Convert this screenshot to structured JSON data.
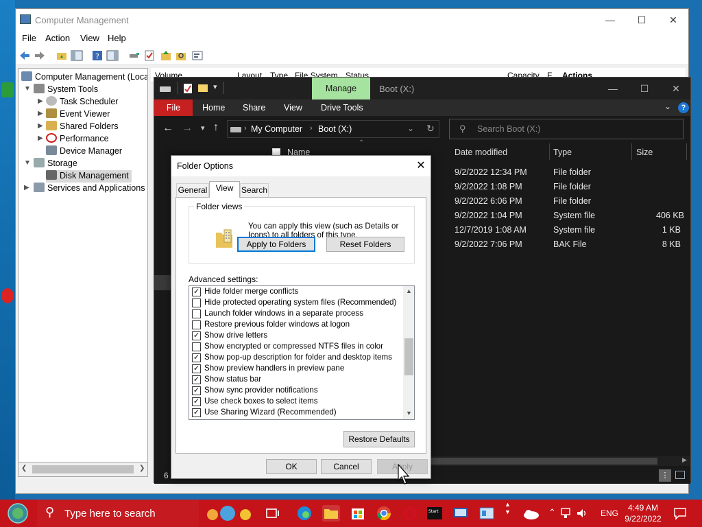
{
  "cm": {
    "title": "Computer Management",
    "menu": [
      "File",
      "Action",
      "View",
      "Help"
    ],
    "tree": {
      "root": "Computer Management (Local",
      "system_tools": "System Tools",
      "task_scheduler": "Task Scheduler",
      "event_viewer": "Event Viewer",
      "shared_folders": "Shared Folders",
      "performance": "Performance",
      "device_manager": "Device Manager",
      "storage": "Storage",
      "disk_management": "Disk Management",
      "services": "Services and Applications"
    },
    "list_headers": [
      "Volume",
      "Layout",
      "Type",
      "File System",
      "Status",
      "Capacity",
      "F",
      "Actions"
    ]
  },
  "fe": {
    "manage_tab": "Manage",
    "title": "Boot (X:)",
    "ribbon": [
      "File",
      "Home",
      "Share",
      "View",
      "Drive Tools"
    ],
    "breadcrumb": [
      "My Computer",
      "Boot (X:)"
    ],
    "search_placeholder": "Search Boot (X:)",
    "columns": [
      "Name",
      "Date modified",
      "Type",
      "Size"
    ],
    "rows": [
      {
        "date": "9/2/2022 12:34 PM",
        "type": "File folder",
        "size": ""
      },
      {
        "date": "9/2/2022 1:08 PM",
        "type": "File folder",
        "size": ""
      },
      {
        "date": "9/2/2022 6:06 PM",
        "type": "File folder",
        "size": ""
      },
      {
        "date": "9/2/2022 1:04 PM",
        "type": "System file",
        "size": "406 KB"
      },
      {
        "date": "12/7/2019 1:08 AM",
        "type": "System file",
        "size": "1 KB"
      },
      {
        "date": "9/2/2022 7:06 PM",
        "type": "BAK File",
        "size": "8 KB"
      }
    ],
    "status_count": "6"
  },
  "dialog": {
    "title": "Folder Options",
    "tabs": [
      "General",
      "View",
      "Search"
    ],
    "group_label": "Folder views",
    "group_desc": "You can apply this view (such as Details or Icons) to all folders of this type.",
    "apply_to_folders": "Apply to Folders",
    "reset_folders": "Reset Folders",
    "advanced_label": "Advanced settings:",
    "options": [
      {
        "label": "Hide folder merge conflicts",
        "checked": true
      },
      {
        "label": "Hide protected operating system files (Recommended)",
        "checked": false
      },
      {
        "label": "Launch folder windows in a separate process",
        "checked": false
      },
      {
        "label": "Restore previous folder windows at logon",
        "checked": false
      },
      {
        "label": "Show drive letters",
        "checked": true
      },
      {
        "label": "Show encrypted or compressed NTFS files in color",
        "checked": false
      },
      {
        "label": "Show pop-up description for folder and desktop items",
        "checked": true
      },
      {
        "label": "Show preview handlers in preview pane",
        "checked": true
      },
      {
        "label": "Show status bar",
        "checked": true
      },
      {
        "label": "Show sync provider notifications",
        "checked": true
      },
      {
        "label": "Use check boxes to select items",
        "checked": true
      },
      {
        "label": "Use Sharing Wizard (Recommended)",
        "checked": true
      }
    ],
    "restore_defaults": "Restore Defaults",
    "ok": "OK",
    "cancel": "Cancel",
    "apply": "Apply"
  },
  "taskbar": {
    "search_placeholder": "Type here to search",
    "language": "ENG",
    "time": "4:49 AM",
    "date": "9/22/2022"
  }
}
